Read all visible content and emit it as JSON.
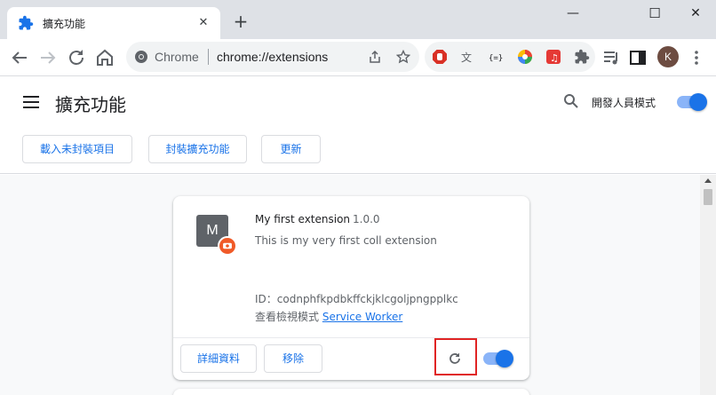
{
  "tab": {
    "title": "擴充功能",
    "close": "✕",
    "new_tab": "+"
  },
  "window": {
    "minimize": "—",
    "maximize": "☐",
    "close": "✕"
  },
  "omnibox": {
    "origin": "Chrome",
    "url": "chrome://extensions"
  },
  "profile": {
    "initial": "K"
  },
  "header": {
    "title": "擴充功能",
    "dev_mode_label": "開發人員模式",
    "dev_mode_enabled": true,
    "buttons": {
      "load_unpacked": "載入未封裝項目",
      "pack": "封裝擴充功能",
      "update": "更新"
    }
  },
  "extension": {
    "logo_letter": "M",
    "name": "My first extension",
    "version": "1.0.0",
    "description": "This is my very first coll extension",
    "id_label": "ID：codnphfkpdbkffckjklcgoljpngpplkc",
    "inspect_label": "查看檢視模式",
    "service_worker": "Service Worker",
    "details_button": "詳細資料",
    "remove_button": "移除",
    "enabled": true
  },
  "colors": {
    "accent": "#1a73e8",
    "highlight": "#e02424",
    "badge": "#f05a28"
  }
}
